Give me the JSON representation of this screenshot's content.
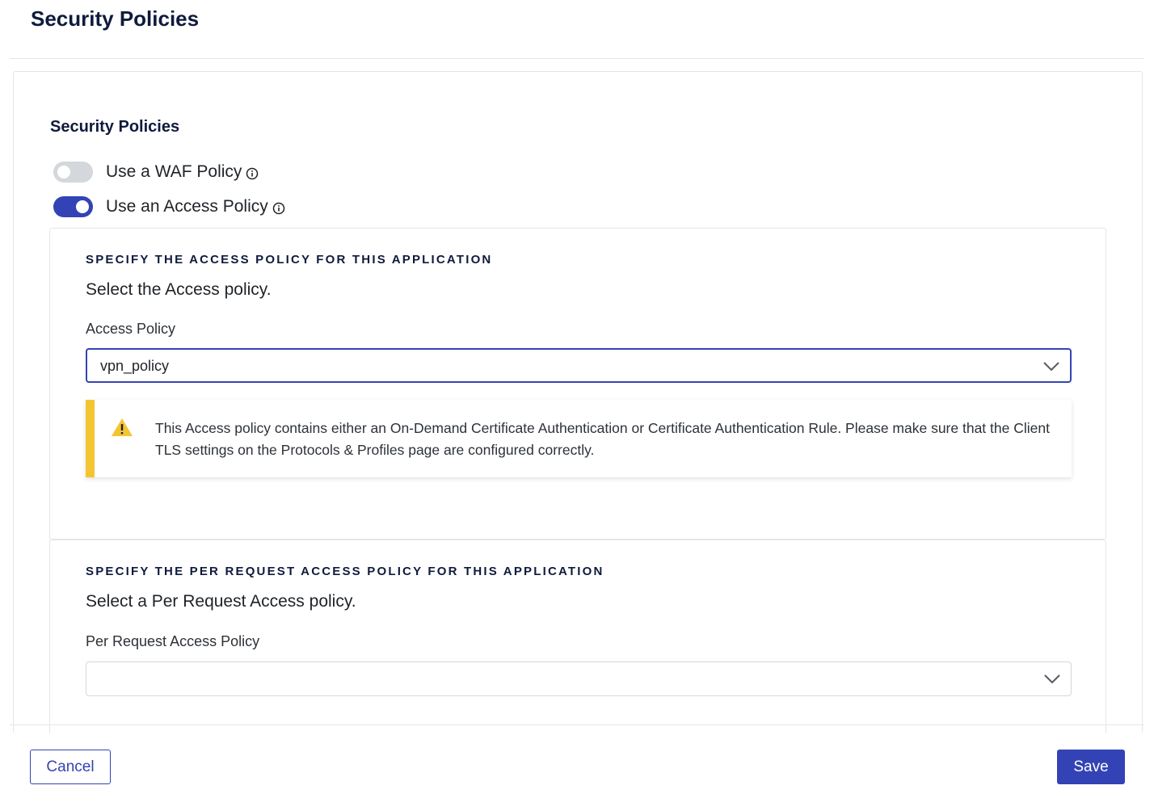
{
  "header": {
    "title": "Security Policies"
  },
  "section": {
    "title": "Security Policies",
    "toggles": [
      {
        "label": "Use a WAF Policy",
        "enabled": false,
        "icon": "info-icon"
      },
      {
        "label": "Use an Access Policy",
        "enabled": true,
        "icon": "info-icon"
      }
    ]
  },
  "access_policy": {
    "heading": "SPECIFY THE ACCESS POLICY FOR THIS APPLICATION",
    "description": "Select the Access policy.",
    "field_label": "Access Policy",
    "selected_value": "vpn_policy",
    "alert": {
      "icon": "warning-icon",
      "text": "This Access policy contains either an On-Demand Certificate Authentication or Certificate Authentication Rule. Please make sure that the Client TLS settings on the Protocols & Profiles page are configured correctly."
    }
  },
  "per_request_policy": {
    "heading": "SPECIFY THE PER REQUEST ACCESS POLICY FOR THIS APPLICATION",
    "description": "Select a Per Request Access policy.",
    "field_label": "Per Request Access Policy",
    "selected_value": ""
  },
  "footer": {
    "cancel_label": "Cancel",
    "save_label": "Save"
  },
  "colors": {
    "accent": "#3343b5",
    "warning": "#f3c533",
    "title": "#0f1a3c",
    "toggle_off": "#d4d7dc"
  }
}
